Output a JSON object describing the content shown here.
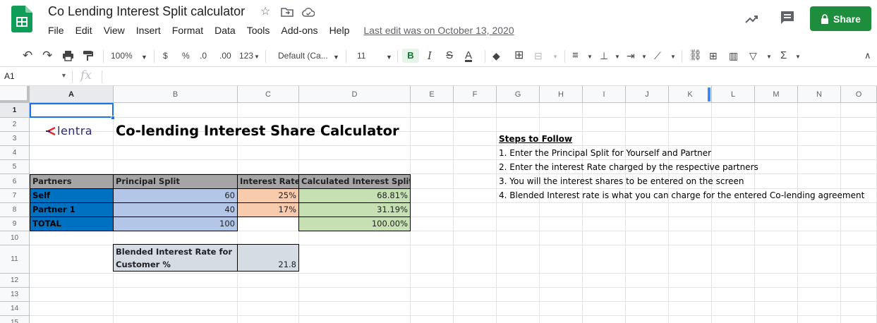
{
  "app": {
    "doc_title": "Co Lending Interest Split calculator",
    "menu": [
      "File",
      "Edit",
      "View",
      "Insert",
      "Format",
      "Data",
      "Tools",
      "Add-ons",
      "Help"
    ],
    "last_edit": "Last edit was on October 13, 2020",
    "share_label": "Share",
    "brand_color": "#1e8e3e"
  },
  "toolbar": {
    "zoom": "100%",
    "currency": "$",
    "percent": "%",
    "decrease_decimal": ".0",
    "increase_decimal": ".00",
    "more_formats": "123",
    "font": "Default (Ca...",
    "font_size": "11",
    "bold": "B",
    "italic": "I",
    "strike": "S",
    "text_color": "A"
  },
  "formula_bar": {
    "cell_ref": "A1",
    "fx": "fx"
  },
  "grid": {
    "columns": [
      "A",
      "B",
      "C",
      "D",
      "E",
      "F",
      "G",
      "H",
      "I",
      "J",
      "K",
      "L",
      "M",
      "N",
      "O"
    ],
    "rows": [
      "1",
      "2",
      "3",
      "4",
      "5",
      "6",
      "7",
      "8",
      "9",
      "10",
      "11",
      "12",
      "13",
      "14",
      "15"
    ]
  },
  "sheet": {
    "logo_text": "lentra",
    "title": "Co-lending Interest Share Calculator",
    "table": {
      "headers": [
        "Partners",
        "Principal Split",
        "Interest Rate",
        "Calculated Interest Split"
      ],
      "rows": [
        [
          "Self",
          "60",
          "25%",
          "68.81%"
        ],
        [
          "Partner 1",
          "40",
          "17%",
          "31.19%"
        ],
        [
          "TOTAL",
          "100",
          "",
          "100.00%"
        ]
      ]
    },
    "blended_label_1": "Blended Interest Rate for",
    "blended_label_2": "Customer %",
    "blended_value": "21.8",
    "steps_title": "Steps to Follow",
    "steps": [
      "1. Enter the Principal Split for Yourself and Partner",
      "2. Enter the interest Rate charged by the respective partners",
      "3. You will the interest shares to be entered on the screen",
      "4. Blended Interest rate is what you can charge for the entered Co-lending agreement"
    ],
    "colors": {
      "header_gray": "#a5a5a5",
      "partner_blue": "#0070c0",
      "principal_blue": "#b4c6e7",
      "rate_orange": "#f8cbad",
      "split_green": "#c6e0b4",
      "blended_gray": "#d6dce4"
    }
  }
}
